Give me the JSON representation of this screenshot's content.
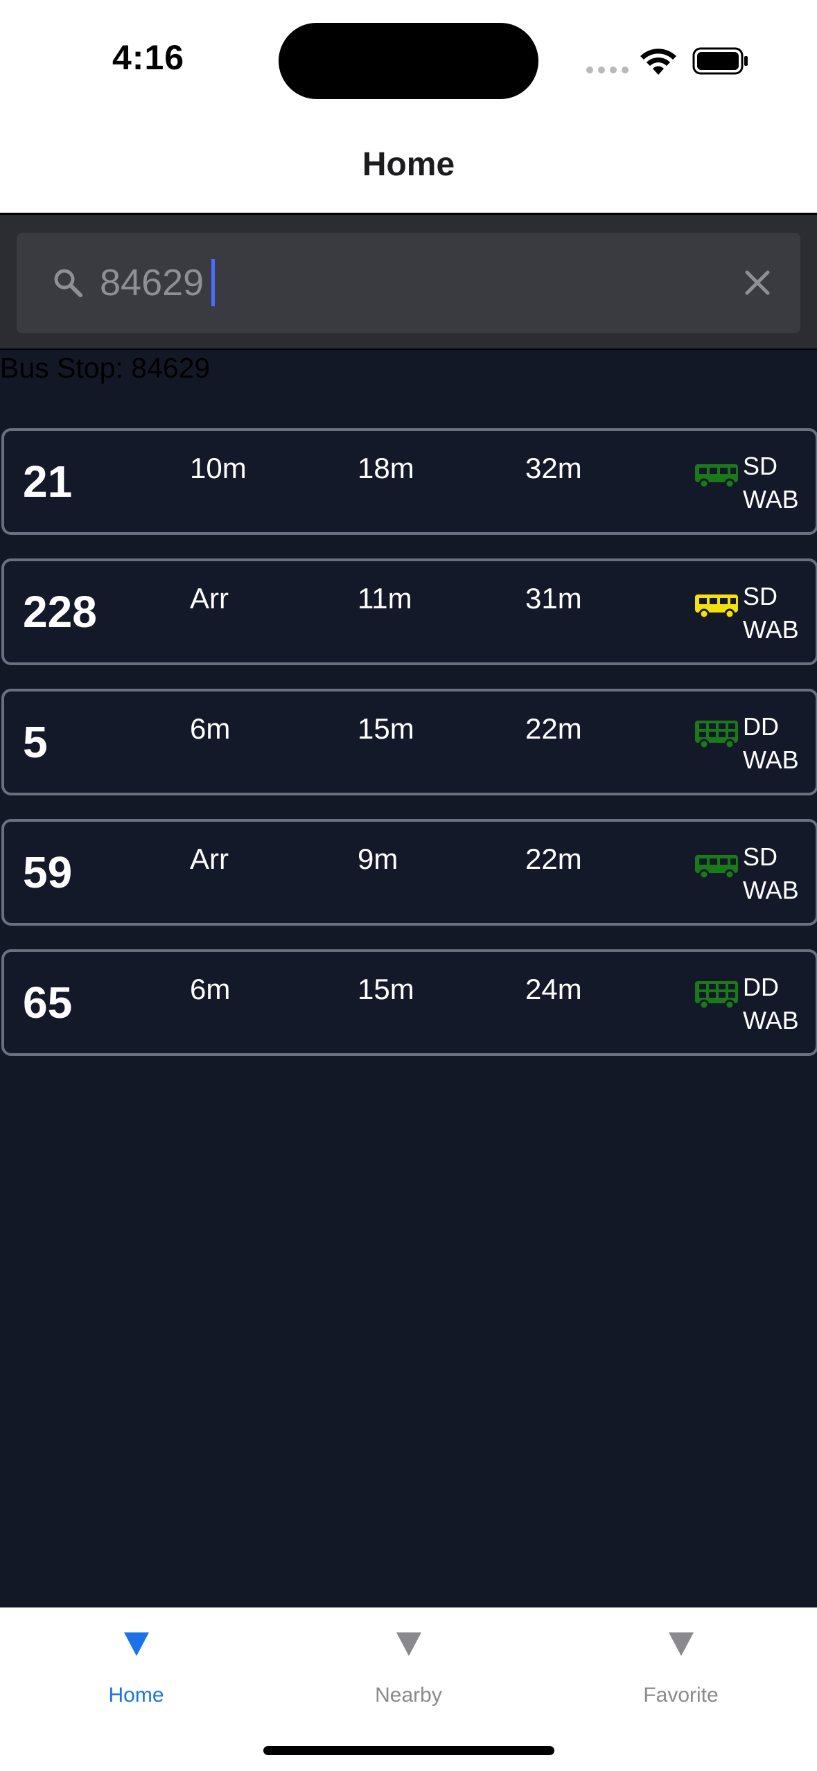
{
  "status_bar": {
    "time": "4:16"
  },
  "header": {
    "title": "Home"
  },
  "search": {
    "value": "84629",
    "placeholder": ""
  },
  "bus_stop": {
    "label": "Bus Stop: 84629"
  },
  "colors": {
    "background": "#131827",
    "card_border": "#6b7080",
    "bus_green": "#1a7a1a",
    "bus_yellow": "#f5e10a",
    "tab_active": "#1a73e8",
    "tab_inactive": "#8a8a8e"
  },
  "services": [
    {
      "number": "21",
      "eta1": "10m",
      "eta2": "18m",
      "eta3": "32m",
      "type": "SD",
      "operator": "WAB",
      "icon": "single-deck-bus-icon",
      "color": "green"
    },
    {
      "number": "228",
      "eta1": "Arr",
      "eta2": "11m",
      "eta3": "31m",
      "type": "SD",
      "operator": "WAB",
      "icon": "single-deck-bus-icon",
      "color": "yellow"
    },
    {
      "number": "5",
      "eta1": "6m",
      "eta2": "15m",
      "eta3": "22m",
      "type": "DD",
      "operator": "WAB",
      "icon": "double-deck-bus-icon",
      "color": "green"
    },
    {
      "number": "59",
      "eta1": "Arr",
      "eta2": "9m",
      "eta3": "22m",
      "type": "SD",
      "operator": "WAB",
      "icon": "single-deck-bus-icon",
      "color": "green"
    },
    {
      "number": "65",
      "eta1": "6m",
      "eta2": "15m",
      "eta3": "24m",
      "type": "DD",
      "operator": "WAB",
      "icon": "double-deck-bus-icon",
      "color": "green"
    }
  ],
  "tabbar": {
    "items": [
      {
        "label": "Home",
        "icon": "triangle-down-icon",
        "active": true
      },
      {
        "label": "Nearby",
        "icon": "triangle-down-icon",
        "active": false
      },
      {
        "label": "Favorite",
        "icon": "triangle-down-icon",
        "active": false
      }
    ]
  }
}
